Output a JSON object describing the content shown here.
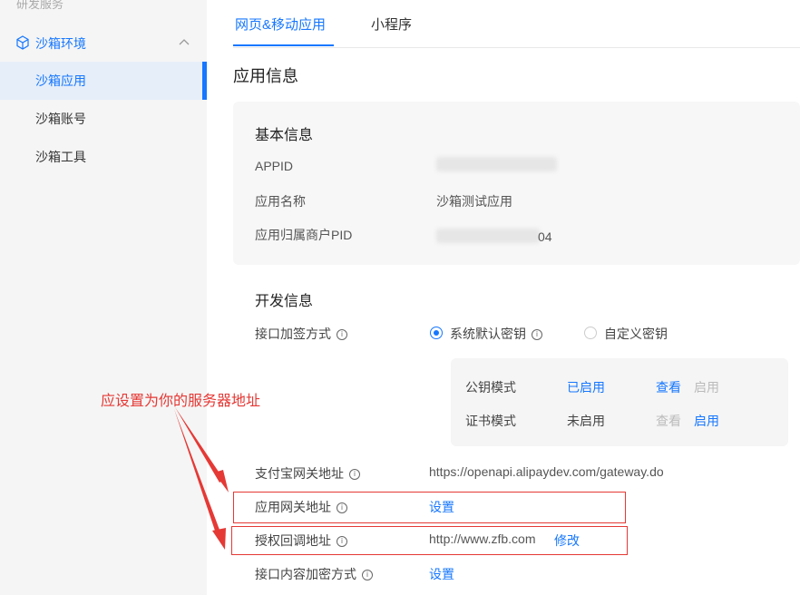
{
  "sidebar": {
    "cut_label": "研发服务",
    "group_label": "沙箱环境",
    "items": [
      "沙箱应用",
      "沙箱账号",
      "沙箱工具"
    ]
  },
  "tabs": [
    "网页&移动应用",
    "小程序"
  ],
  "page_title": "应用信息",
  "basic": {
    "title": "基本信息",
    "appid_label": "APPID",
    "name_label": "应用名称",
    "name_value": "沙箱测试应用",
    "pid_label": "应用归属商户PID",
    "pid_suffix": "04"
  },
  "dev": {
    "title": "开发信息",
    "sign_label": "接口加签方式",
    "opt_default": "系统默认密钥",
    "opt_custom": "自定义密钥",
    "key_modes": [
      {
        "mode": "公钥模式",
        "status": "已启用",
        "view": "查看",
        "enable": "启用"
      },
      {
        "mode": "证书模式",
        "status": "未启用",
        "view": "查看",
        "enable": "启用"
      }
    ],
    "gateway_label": "支付宝网关地址",
    "gateway_value": "https://openapi.alipaydev.com/gateway.do",
    "app_gateway_label": "应用网关地址",
    "app_gateway_action": "设置",
    "callback_label": "授权回调地址",
    "callback_value": "http://www.zfb.com",
    "callback_action": "修改",
    "encrypt_label": "接口内容加密方式",
    "encrypt_action": "设置"
  },
  "annotation": "应设置为你的服务器地址",
  "colors": {
    "accent": "#1677ff",
    "annotation": "#e53935"
  }
}
